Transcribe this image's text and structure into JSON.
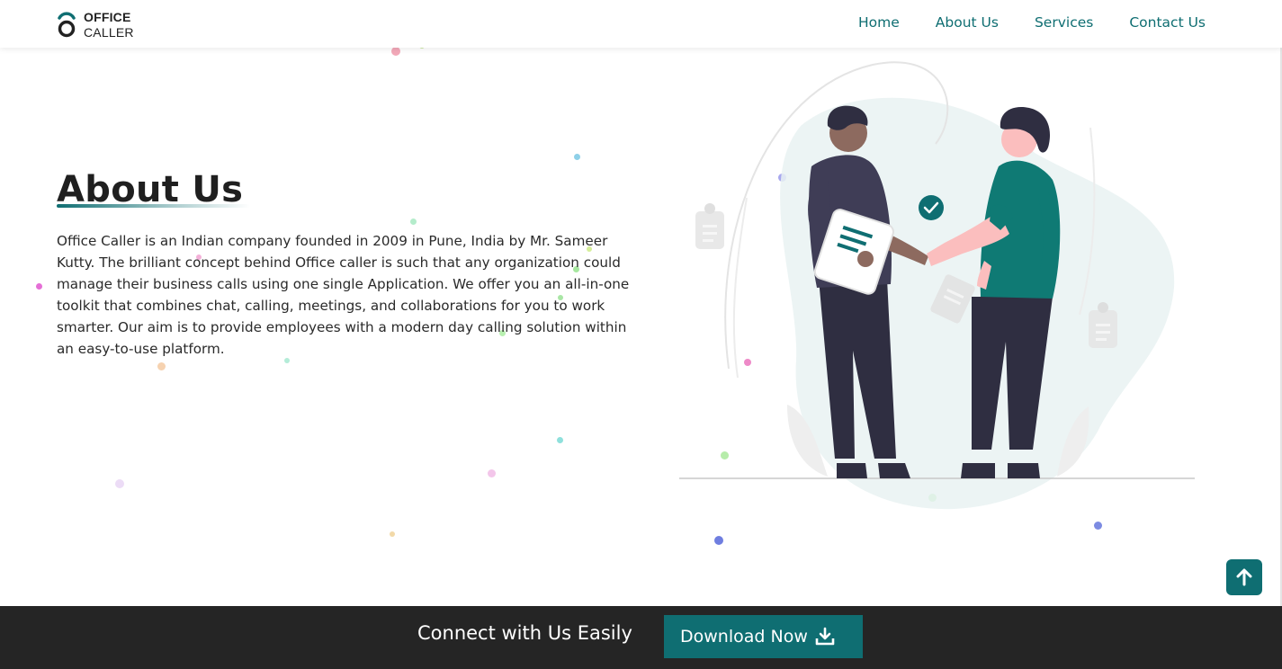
{
  "brand": {
    "line1": "OFFICE",
    "line2": "CALLER",
    "accent_color": "#0f6e72"
  },
  "nav": {
    "items": [
      {
        "label": "Home"
      },
      {
        "label": "About Us"
      },
      {
        "label": "Services"
      },
      {
        "label": "Contact Us"
      }
    ]
  },
  "about": {
    "title": "About Us",
    "body": "Office Caller is an Indian company founded in 2009 in Pune, India by Mr. Sameer Kutty. The brilliant concept behind Office caller is such that any organization could manage their business calls using one single Application. We offer you an all-in-one toolkit that combines chat, calling, meetings, and collaborations for you to work smarter. Our aim is to provide employees with a modern day calling solution within an easy-to-use platform."
  },
  "illustration": {
    "icon": "handshake-illustration"
  },
  "footer": {
    "text": "Connect with Us Easily",
    "download_label": "Download Now",
    "background": "#252525"
  },
  "icons": {
    "back_to_top": "arrow-up-icon",
    "download": "download-icon"
  }
}
